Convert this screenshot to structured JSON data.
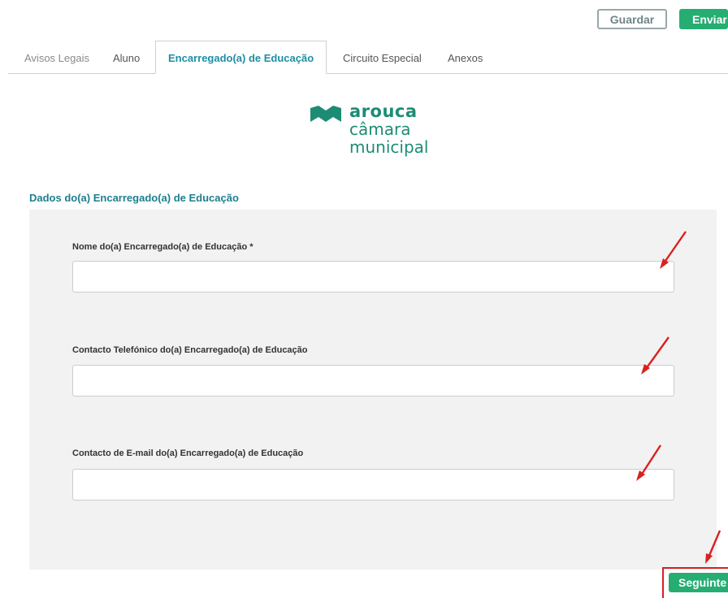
{
  "toolbar": {
    "save_label": "Guardar",
    "send_label": "Enviar"
  },
  "tabs": [
    {
      "label": "Avisos Legais",
      "active": false
    },
    {
      "label": "Aluno",
      "active": false
    },
    {
      "label": "Encarregado(a) de Educação",
      "active": true
    },
    {
      "label": "Circuito Especial",
      "active": false
    },
    {
      "label": "Anexos",
      "active": false
    }
  ],
  "logo": {
    "line1": "arouca",
    "line2": "câmara",
    "line3": "municipal",
    "icon": "arouca-logo-icon",
    "color": "#1d8c74"
  },
  "form": {
    "section_title": "Dados do(a) Encarregado(a) de Educação",
    "fields": [
      {
        "label": "Nome do(a) Encarregado(a) de Educação *",
        "value": "",
        "placeholder": ""
      },
      {
        "label": "Contacto Telefónico do(a) Encarregado(a) de Educação",
        "value": "",
        "placeholder": ""
      },
      {
        "label": "Contacto de E-mail do(a) Encarregado(a) de Educação",
        "value": "",
        "placeholder": ""
      }
    ],
    "next_label": "Seguinte"
  },
  "colors": {
    "accent": "#26ad72",
    "tab_active": "#1f8ea6",
    "annotation": "#d92020",
    "panel": "#f2f2f2"
  }
}
